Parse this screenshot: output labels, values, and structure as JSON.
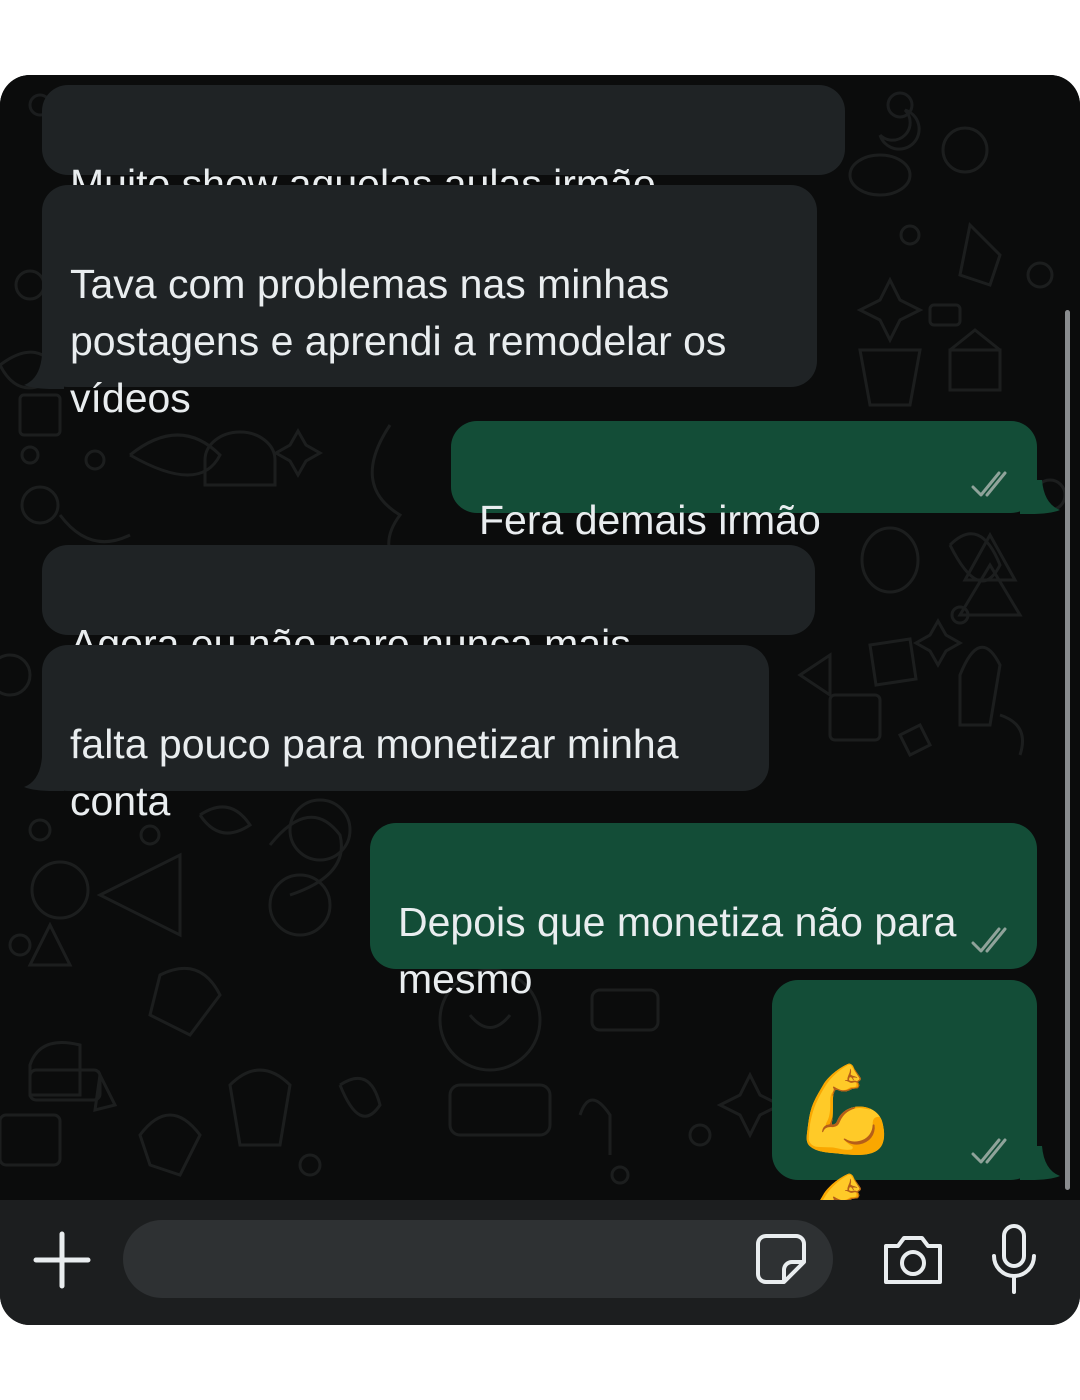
{
  "messages": [
    {
      "direction": "incoming",
      "text": "Muito show aquelas aulas irmão"
    },
    {
      "direction": "incoming",
      "text": "Tava com problemas nas minhas\npostagens e aprendi a remodelar os\nvídeos"
    },
    {
      "direction": "outgoing",
      "text": "Fera demais irmão",
      "status": "read"
    },
    {
      "direction": "incoming",
      "text": "Agora eu não paro nunca mais"
    },
    {
      "direction": "incoming",
      "text": "falta pouco para monetizar minha\nconta"
    },
    {
      "direction": "outgoing",
      "text": "Depois que monetiza não para\nmesmo",
      "status": "read"
    },
    {
      "direction": "outgoing",
      "text": "💪💪",
      "status": "read"
    }
  ],
  "input_bar": {
    "placeholder": "",
    "icons": [
      "plus-icon",
      "sticker-icon",
      "camera-icon",
      "microphone-icon"
    ]
  },
  "colors": {
    "incoming_bubble": "#1f2325",
    "outgoing_bubble": "#134d37",
    "background": "#0b0c0c",
    "ticks": "#8fa39a"
  }
}
